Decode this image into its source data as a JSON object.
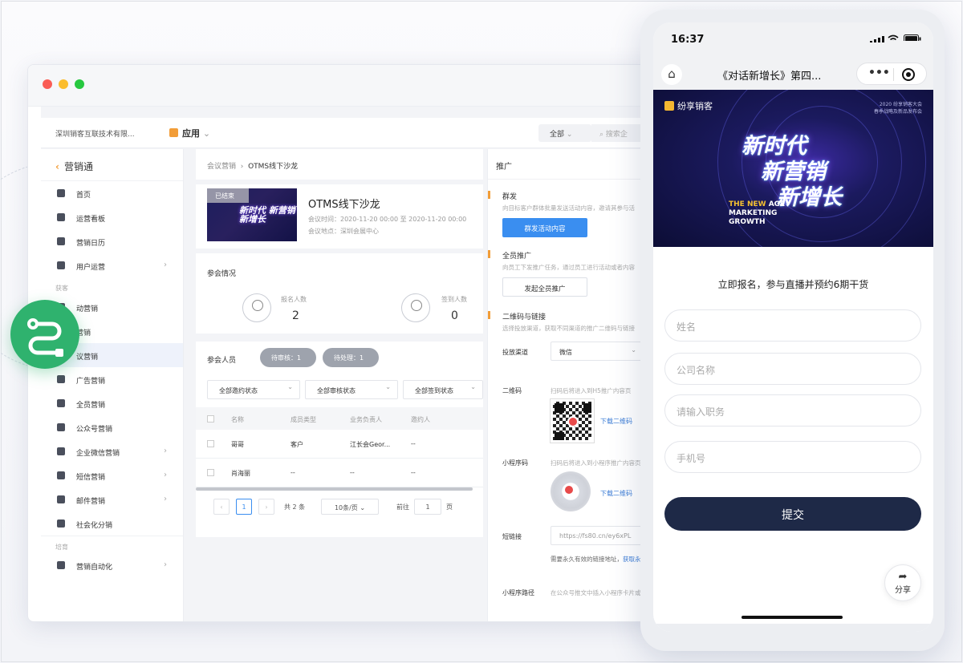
{
  "browser": {
    "company": "深圳销客互联技术有限...",
    "app_menu": "应用",
    "scope": "全部",
    "search_placeholder": "搜索企"
  },
  "sidebar": {
    "title": "营销通",
    "items": [
      {
        "label": "首页",
        "icon": "home-icon",
        "arrow": false
      },
      {
        "label": "运营看板",
        "icon": "dashboard-icon",
        "arrow": false
      },
      {
        "label": "营销日历",
        "icon": "calendar-icon",
        "arrow": false
      },
      {
        "label": "用户运营",
        "icon": "user-icon",
        "arrow": true
      }
    ],
    "group1": "获客",
    "items2": [
      {
        "label": "动营销",
        "icon": "activity-icon",
        "arrow": false
      },
      {
        "label": "营销",
        "icon": "content-icon",
        "arrow": false
      },
      {
        "label": "议营销",
        "icon": "meeting-icon",
        "arrow": false,
        "active": true
      },
      {
        "label": "广告营销",
        "icon": "ad-icon",
        "arrow": false
      },
      {
        "label": "全员营销",
        "icon": "team-icon",
        "arrow": false
      },
      {
        "label": "公众号营销",
        "icon": "wechat-icon",
        "arrow": false
      },
      {
        "label": "企业微信营销",
        "icon": "wecom-icon",
        "arrow": true
      },
      {
        "label": "短信营销",
        "icon": "sms-icon",
        "arrow": true
      },
      {
        "label": "邮件营销",
        "icon": "mail-icon",
        "arrow": true
      },
      {
        "label": "社会化分销",
        "icon": "distribution-icon",
        "arrow": false
      }
    ],
    "group2": "培育",
    "items3": [
      {
        "label": "营销自动化",
        "icon": "automation-icon",
        "arrow": true
      }
    ]
  },
  "breadcrumb": {
    "parent": "会议营销",
    "current": "OTMS线下沙龙"
  },
  "event": {
    "status_tag": "已结束",
    "title": "OTMS线下沙龙",
    "time": "会议时间：2020-11-20 00:00 至 2020-11-20 00:00",
    "location": "会议地点：深圳会展中心",
    "thumb_text": "新时代 新营销 新增长"
  },
  "stats": {
    "title": "参会情况",
    "signup_label": "报名人数",
    "signup_value": "2",
    "checkin_label": "签到人数",
    "checkin_value": "0"
  },
  "attendees": {
    "title": "参会人员",
    "pill_pending": "待审核：1",
    "pill_todo": "待处理：1",
    "filter_invite": "全部邀约状态",
    "filter_review": "全部审核状态",
    "filter_checkin": "全部签到状态",
    "columns": [
      "名称",
      "成员类型",
      "业务负责人",
      "邀约人"
    ],
    "rows": [
      [
        "哥哥",
        "客户",
        "江长会Geor...",
        "--"
      ],
      [
        "肖海丽",
        "--",
        "--",
        "--"
      ]
    ],
    "pager": {
      "page": "1",
      "total": "共 2 条",
      "size": "10条/页",
      "goto_label": "前往",
      "goto_value": "1",
      "goto_unit": "页"
    }
  },
  "promo": {
    "header": "推广",
    "mass_title": "群发",
    "mass_hint": "向目标客户群体批量发送活动内容，邀请其参与活",
    "mass_button": "群发活动内容",
    "staff_title": "全员推广",
    "staff_hint": "向员工下发推广任务，通过员工进行活动或者内容",
    "staff_button": "发起全员推广",
    "qr_title": "二维码与链接",
    "qr_hint": "选择投放渠道，获取不同渠道的推广二维码与链接",
    "channel_label": "投放渠道",
    "channel_value": "微信",
    "qrcode_label": "二维码",
    "qrcode_hint": "扫码后将进入到H5推广内容页",
    "qrcode_download": "下载二维码",
    "mini_label": "小程序码",
    "mini_hint": "扫码后将进入到小程序推广内容页",
    "mini_download": "下载二维码",
    "short_label": "短链接",
    "short_value": "https://fs80.cn/ey6xPL",
    "short_hint": "需要永久有效的链接地址，",
    "short_link": "获取永",
    "path_label": "小程序路径",
    "path_hint": "在公众号推文中插入小程序卡片或"
  },
  "phone": {
    "time": "16:37",
    "title": "《对话新增长》第四...",
    "banner_brand": "纷享销客",
    "banner_tag": "2020 纷享销客大会\n春季战略及新品发布会",
    "banner_line1": "新时代",
    "banner_line2": "新营销",
    "banner_line3": "新增长",
    "banner_sub1": "THE NEW",
    "banner_sub1b": "AGE",
    "banner_sub2": "MARKETING",
    "banner_sub3": "GROWTH",
    "intro": "立即报名，参与直播并预约6期干货",
    "fields": [
      "姓名",
      "公司名称",
      "请输入职务",
      "手机号"
    ],
    "submit": "提交",
    "share": "分享"
  },
  "colors": {
    "accent": "#f29d38",
    "primary": "#3a8ef0",
    "badge": "#2fb26e",
    "submit": "#1e2947"
  }
}
